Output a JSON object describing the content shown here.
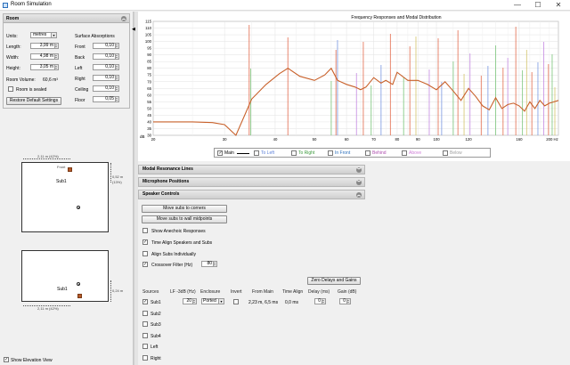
{
  "window": {
    "title": "Room Simulation",
    "min": "—",
    "max": "☐",
    "close": "✕"
  },
  "room": {
    "header": "Room",
    "units_label": "Units:",
    "units_value": "metres",
    "length_label": "Length:",
    "length_value": "3,99 m",
    "width_label": "Width:",
    "width_value": "4,98 m",
    "height_label": "Height:",
    "height_value": "3,05 m",
    "volume_label": "Room Volume:",
    "volume_value": "60,6 m³",
    "sealed_label": "Room is sealed",
    "restore_label": "Restore Default Settings",
    "absorption_header": "Surface Absorptions",
    "surfaces": [
      {
        "label": "Front",
        "value": "0,10"
      },
      {
        "label": "Back",
        "value": "0,10"
      },
      {
        "label": "Left",
        "value": "0,10"
      },
      {
        "label": "Right",
        "value": "0,10"
      },
      {
        "label": "Ceiling",
        "value": "0,10"
      },
      {
        "label": "Floor",
        "value": "0,05"
      }
    ]
  },
  "plan_view": {
    "top_dim": "2,11 m (42%)",
    "front_label": "Front",
    "sub_label": "Sub1",
    "side_dim_a": "0,52 m",
    "side_dim_b": "(13%)"
  },
  "elevation_view": {
    "sub_label": "Sub1",
    "side_dim": "0,24 m",
    "bottom_dim": "2,11 m (42%)"
  },
  "show_elevation_label": "Show Elevation View",
  "chart_data": {
    "type": "line",
    "title": "Frequency Responses and Modal Distribution",
    "ylabel": "dB",
    "xlabel": "Hz",
    "y_ticks": [
      "115",
      "110",
      "105",
      "100",
      "95",
      "90",
      "85",
      "80",
      "75",
      "70",
      "65",
      "60",
      "55",
      "50",
      "45",
      "40",
      "35",
      "30"
    ],
    "x_ticks": [
      "20",
      "30",
      "40",
      "50",
      "60",
      "70",
      "80",
      "90",
      "100",
      "120",
      "160",
      "200 Hz"
    ],
    "ylim": [
      30,
      115
    ],
    "xlim": [
      20,
      200
    ],
    "log_x": true,
    "grid": true,
    "series": [
      {
        "name": "Main",
        "color": "#c8602a",
        "x": [
          20,
          25,
          28,
          30,
          32,
          35,
          38,
          41,
          43,
          46,
          50,
          53,
          55,
          57,
          60,
          63,
          65,
          67,
          70,
          73,
          75,
          78,
          80,
          85,
          90,
          95,
          100,
          105,
          110,
          115,
          120,
          125,
          130,
          135,
          140,
          145,
          150,
          155,
          160,
          165,
          170,
          175,
          180,
          185,
          190,
          195,
          200
        ],
        "y": [
          40,
          40,
          39.5,
          38,
          30,
          57,
          68,
          76,
          80,
          74,
          71,
          75,
          80,
          71,
          68,
          66,
          64,
          66,
          73,
          69,
          71,
          68,
          77,
          71,
          71,
          68,
          64,
          70,
          63,
          56,
          65,
          59,
          52,
          49,
          58,
          50,
          53,
          54,
          52,
          48,
          55,
          50,
          56,
          52,
          54,
          55,
          56
        ]
      }
    ],
    "modes": [
      {
        "x": 34.5,
        "color": "#e06040"
      },
      {
        "x": 34.8,
        "color": "#70c070"
      },
      {
        "x": 43,
        "color": "#e06040"
      },
      {
        "x": 55,
        "color": "#70c070"
      },
      {
        "x": 56.5,
        "color": "#e06040"
      },
      {
        "x": 57,
        "color": "#7090e0"
      },
      {
        "x": 63.5,
        "color": "#c080e0"
      },
      {
        "x": 66,
        "color": "#e06040"
      },
      {
        "x": 69,
        "color": "#70c070"
      },
      {
        "x": 73,
        "color": "#7090e0"
      },
      {
        "x": 77,
        "color": "#e06040"
      },
      {
        "x": 83,
        "color": "#70c070"
      },
      {
        "x": 86,
        "color": "#e06040"
      },
      {
        "x": 89,
        "color": "#d0c060"
      },
      {
        "x": 96,
        "color": "#c080e0"
      },
      {
        "x": 101,
        "color": "#e06040"
      },
      {
        "x": 103,
        "color": "#7090e0"
      },
      {
        "x": 110,
        "color": "#70c070"
      },
      {
        "x": 113,
        "color": "#e06040"
      },
      {
        "x": 117,
        "color": "#d0c060"
      },
      {
        "x": 121,
        "color": "#c080e0"
      },
      {
        "x": 129,
        "color": "#e06040"
      },
      {
        "x": 134,
        "color": "#7090e0"
      },
      {
        "x": 140,
        "color": "#70c070"
      },
      {
        "x": 146,
        "color": "#e06040"
      },
      {
        "x": 150,
        "color": "#c080e0"
      },
      {
        "x": 157,
        "color": "#e06040"
      },
      {
        "x": 163,
        "color": "#70c070"
      },
      {
        "x": 167,
        "color": "#d0c060"
      },
      {
        "x": 172,
        "color": "#e06040"
      },
      {
        "x": 178,
        "color": "#7090e0"
      },
      {
        "x": 184,
        "color": "#c080e0"
      },
      {
        "x": 189,
        "color": "#e06040"
      },
      {
        "x": 193,
        "color": "#70c070"
      },
      {
        "x": 196,
        "color": "#d0c060"
      }
    ],
    "legend": [
      {
        "label": "Main",
        "color": "#000000",
        "checked": true
      },
      {
        "label": "To Left",
        "color": "#5b7fd8",
        "checked": false
      },
      {
        "label": "To Right",
        "color": "#3c9a3c",
        "checked": false
      },
      {
        "label": "In Front",
        "color": "#2a6ebb",
        "checked": false
      },
      {
        "label": "Behind",
        "color": "#b050b0",
        "checked": false
      },
      {
        "label": "Above",
        "color": "#d080d8",
        "checked": false
      },
      {
        "label": "Below",
        "color": "#a0a0a0",
        "checked": false
      }
    ]
  },
  "panels": {
    "modal": "Modal Resonance Lines",
    "mic": "Microphone Positions",
    "speaker": "Speaker Controls"
  },
  "speaker_controls": {
    "move_corners": "Move subs to corners",
    "move_midpoints": "Move subs to wall midpoints",
    "show_anechoic": "Show Anechoic Responses",
    "time_align": "Time Align Speakers and Subs",
    "align_individually": "Align Subs Individually",
    "crossover_label": "Crossover Filter (Hz)",
    "crossover_value": "80",
    "zero_delays": "Zero Delays and Gains",
    "columns": [
      "Sources",
      "LF -3dB (Hz)",
      "Enclosure",
      "Invert",
      "From Main",
      "Time Align",
      "Delay (ms)",
      "Gain (dB)"
    ],
    "sources": [
      {
        "name": "Sub1",
        "checked": true,
        "lf": "20",
        "enclosure": "Ported",
        "from_main": "2,23 m, 6,5 ms",
        "time_align": "0,0 ms",
        "delay": "0",
        "gain": "0"
      },
      {
        "name": "Sub2",
        "checked": false
      },
      {
        "name": "Sub3",
        "checked": false
      },
      {
        "name": "Sub4",
        "checked": false
      },
      {
        "name": "Left",
        "checked": false
      },
      {
        "name": "Right",
        "checked": false
      }
    ]
  }
}
